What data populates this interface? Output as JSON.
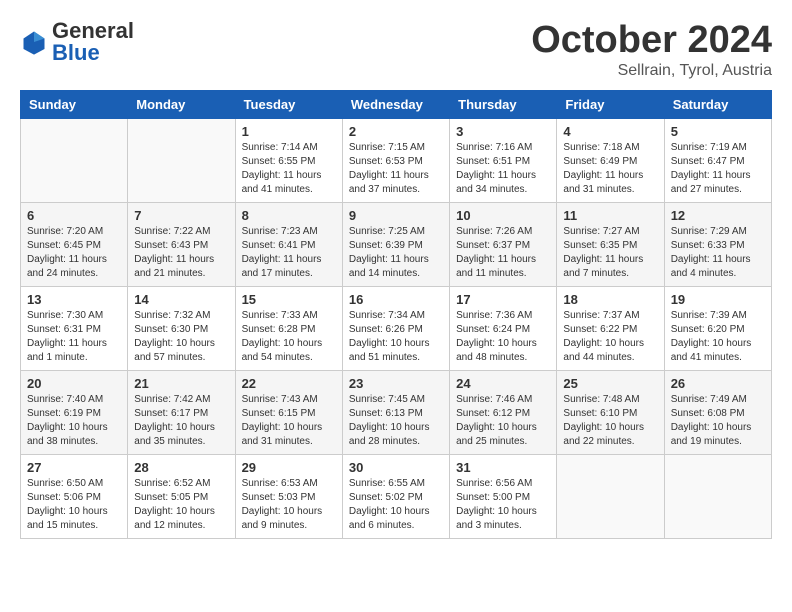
{
  "header": {
    "logo": {
      "general": "General",
      "blue": "Blue"
    },
    "title": "October 2024",
    "location": "Sellrain, Tyrol, Austria"
  },
  "weekdays": [
    "Sunday",
    "Monday",
    "Tuesday",
    "Wednesday",
    "Thursday",
    "Friday",
    "Saturday"
  ],
  "weeks": [
    [
      {
        "day": "",
        "info": ""
      },
      {
        "day": "",
        "info": ""
      },
      {
        "day": "1",
        "info": "Sunrise: 7:14 AM\nSunset: 6:55 PM\nDaylight: 11 hours and 41 minutes."
      },
      {
        "day": "2",
        "info": "Sunrise: 7:15 AM\nSunset: 6:53 PM\nDaylight: 11 hours and 37 minutes."
      },
      {
        "day": "3",
        "info": "Sunrise: 7:16 AM\nSunset: 6:51 PM\nDaylight: 11 hours and 34 minutes."
      },
      {
        "day": "4",
        "info": "Sunrise: 7:18 AM\nSunset: 6:49 PM\nDaylight: 11 hours and 31 minutes."
      },
      {
        "day": "5",
        "info": "Sunrise: 7:19 AM\nSunset: 6:47 PM\nDaylight: 11 hours and 27 minutes."
      }
    ],
    [
      {
        "day": "6",
        "info": "Sunrise: 7:20 AM\nSunset: 6:45 PM\nDaylight: 11 hours and 24 minutes."
      },
      {
        "day": "7",
        "info": "Sunrise: 7:22 AM\nSunset: 6:43 PM\nDaylight: 11 hours and 21 minutes."
      },
      {
        "day": "8",
        "info": "Sunrise: 7:23 AM\nSunset: 6:41 PM\nDaylight: 11 hours and 17 minutes."
      },
      {
        "day": "9",
        "info": "Sunrise: 7:25 AM\nSunset: 6:39 PM\nDaylight: 11 hours and 14 minutes."
      },
      {
        "day": "10",
        "info": "Sunrise: 7:26 AM\nSunset: 6:37 PM\nDaylight: 11 hours and 11 minutes."
      },
      {
        "day": "11",
        "info": "Sunrise: 7:27 AM\nSunset: 6:35 PM\nDaylight: 11 hours and 7 minutes."
      },
      {
        "day": "12",
        "info": "Sunrise: 7:29 AM\nSunset: 6:33 PM\nDaylight: 11 hours and 4 minutes."
      }
    ],
    [
      {
        "day": "13",
        "info": "Sunrise: 7:30 AM\nSunset: 6:31 PM\nDaylight: 11 hours and 1 minute."
      },
      {
        "day": "14",
        "info": "Sunrise: 7:32 AM\nSunset: 6:30 PM\nDaylight: 10 hours and 57 minutes."
      },
      {
        "day": "15",
        "info": "Sunrise: 7:33 AM\nSunset: 6:28 PM\nDaylight: 10 hours and 54 minutes."
      },
      {
        "day": "16",
        "info": "Sunrise: 7:34 AM\nSunset: 6:26 PM\nDaylight: 10 hours and 51 minutes."
      },
      {
        "day": "17",
        "info": "Sunrise: 7:36 AM\nSunset: 6:24 PM\nDaylight: 10 hours and 48 minutes."
      },
      {
        "day": "18",
        "info": "Sunrise: 7:37 AM\nSunset: 6:22 PM\nDaylight: 10 hours and 44 minutes."
      },
      {
        "day": "19",
        "info": "Sunrise: 7:39 AM\nSunset: 6:20 PM\nDaylight: 10 hours and 41 minutes."
      }
    ],
    [
      {
        "day": "20",
        "info": "Sunrise: 7:40 AM\nSunset: 6:19 PM\nDaylight: 10 hours and 38 minutes."
      },
      {
        "day": "21",
        "info": "Sunrise: 7:42 AM\nSunset: 6:17 PM\nDaylight: 10 hours and 35 minutes."
      },
      {
        "day": "22",
        "info": "Sunrise: 7:43 AM\nSunset: 6:15 PM\nDaylight: 10 hours and 31 minutes."
      },
      {
        "day": "23",
        "info": "Sunrise: 7:45 AM\nSunset: 6:13 PM\nDaylight: 10 hours and 28 minutes."
      },
      {
        "day": "24",
        "info": "Sunrise: 7:46 AM\nSunset: 6:12 PM\nDaylight: 10 hours and 25 minutes."
      },
      {
        "day": "25",
        "info": "Sunrise: 7:48 AM\nSunset: 6:10 PM\nDaylight: 10 hours and 22 minutes."
      },
      {
        "day": "26",
        "info": "Sunrise: 7:49 AM\nSunset: 6:08 PM\nDaylight: 10 hours and 19 minutes."
      }
    ],
    [
      {
        "day": "27",
        "info": "Sunrise: 6:50 AM\nSunset: 5:06 PM\nDaylight: 10 hours and 15 minutes."
      },
      {
        "day": "28",
        "info": "Sunrise: 6:52 AM\nSunset: 5:05 PM\nDaylight: 10 hours and 12 minutes."
      },
      {
        "day": "29",
        "info": "Sunrise: 6:53 AM\nSunset: 5:03 PM\nDaylight: 10 hours and 9 minutes."
      },
      {
        "day": "30",
        "info": "Sunrise: 6:55 AM\nSunset: 5:02 PM\nDaylight: 10 hours and 6 minutes."
      },
      {
        "day": "31",
        "info": "Sunrise: 6:56 AM\nSunset: 5:00 PM\nDaylight: 10 hours and 3 minutes."
      },
      {
        "day": "",
        "info": ""
      },
      {
        "day": "",
        "info": ""
      }
    ]
  ]
}
